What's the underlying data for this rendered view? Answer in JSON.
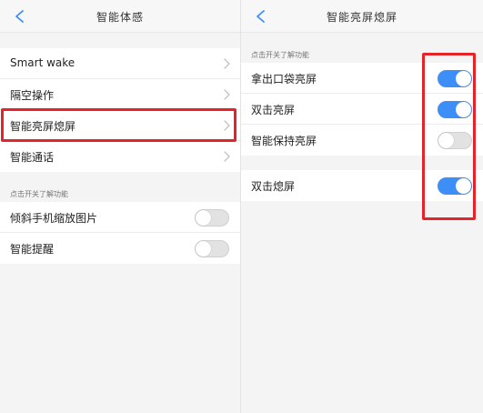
{
  "left": {
    "title": "智能体感",
    "menu_items": [
      {
        "label": "Smart wake"
      },
      {
        "label": "隔空操作"
      },
      {
        "label": "智能亮屏熄屏"
      },
      {
        "label": "智能通话"
      }
    ],
    "section_header": "点击开关了解功能",
    "toggle_items": [
      {
        "label": "倾斜手机缩放图片",
        "on": false
      },
      {
        "label": "智能提醒",
        "on": false
      }
    ]
  },
  "right": {
    "title": "智能亮屏熄屏",
    "section_header": "点击开关了解功能",
    "toggle_items": [
      {
        "label": "拿出口袋亮屏",
        "on": true
      },
      {
        "label": "双击亮屏",
        "on": true
      },
      {
        "label": "智能保持亮屏",
        "on": false
      }
    ],
    "toggle_items_2": [
      {
        "label": "双击熄屏",
        "on": true
      }
    ]
  },
  "colors": {
    "accent": "#3e8ef7",
    "highlight": "#e5242a",
    "toggle_off": "#e2e2e2"
  }
}
